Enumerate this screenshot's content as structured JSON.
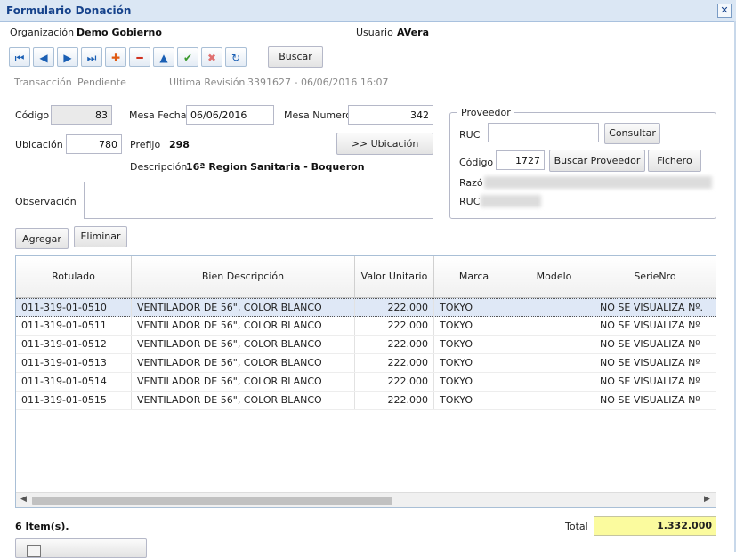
{
  "window": {
    "title": "Formulario Donación"
  },
  "header": {
    "org_label": "Organización",
    "org_value": "Demo Gobierno",
    "user_label": "Usuario",
    "user_value": "AVera"
  },
  "toolbar": {
    "buscar": "Buscar"
  },
  "status": {
    "transaccion_label": "Transacción",
    "transaccion_value": "Pendiente",
    "revision_label": "Ultima Revisión",
    "revision_value": "3391627 - 06/06/2016 16:07"
  },
  "form": {
    "codigo_label": "Código",
    "codigo_value": "83",
    "mesa_fecha_label": "Mesa Fecha",
    "mesa_fecha_value": "06/06/2016",
    "mesa_numero_label": "Mesa Numero",
    "mesa_numero_value": "342",
    "ubicacion_label": "Ubicación",
    "ubicacion_value": "780",
    "prefijo_label": "Prefijo",
    "prefijo_value": "298",
    "ubicacion_button": ">> Ubicación",
    "descripcion_label": "Descripción",
    "descripcion_value": "16ª Region Sanitaria - Boqueron",
    "observacion_label": "Observación",
    "observacion_value": ""
  },
  "proveedor": {
    "legend": "Proveedor",
    "ruc_label": "RUC",
    "ruc_value": "",
    "consultar": "Consultar",
    "codigo_label": "Código",
    "codigo_value": "1727",
    "buscar_proveedor": "Buscar Proveedor",
    "fichero": "Fichero",
    "razon_label": "Razó",
    "ruc2_label": "RUC"
  },
  "actions": {
    "agregar": "Agregar",
    "eliminar": "Eliminar"
  },
  "grid": {
    "columns": [
      "Rotulado",
      "Bien Descripción",
      "Valor Unitario",
      "Marca",
      "Modelo",
      "SerieNro"
    ],
    "rows": [
      [
        "011-319-01-0510",
        "VENTILADOR DE 56\", COLOR BLANCO",
        "222.000",
        "TOKYO",
        "",
        "NO SE VISUALIZA Nº."
      ],
      [
        "011-319-01-0511",
        "VENTILADOR DE 56\", COLOR BLANCO",
        "222.000",
        "TOKYO",
        "",
        "NO SE VISUALIZA Nº"
      ],
      [
        "011-319-01-0512",
        "VENTILADOR DE 56\", COLOR BLANCO",
        "222.000",
        "TOKYO",
        "",
        "NO SE VISUALIZA Nº"
      ],
      [
        "011-319-01-0513",
        "VENTILADOR DE 56\", COLOR BLANCO",
        "222.000",
        "TOKYO",
        "",
        "NO SE VISUALIZA Nº"
      ],
      [
        "011-319-01-0514",
        "VENTILADOR DE 56\", COLOR BLANCO",
        "222.000",
        "TOKYO",
        "",
        "NO SE VISUALIZA Nº"
      ],
      [
        "011-319-01-0515",
        "VENTILADOR DE 56\", COLOR BLANCO",
        "222.000",
        "TOKYO",
        "",
        "NO SE VISUALIZA Nº"
      ]
    ]
  },
  "footer": {
    "items": "6 Item(s).",
    "total_label": "Total",
    "total_value": "1.332.000"
  }
}
